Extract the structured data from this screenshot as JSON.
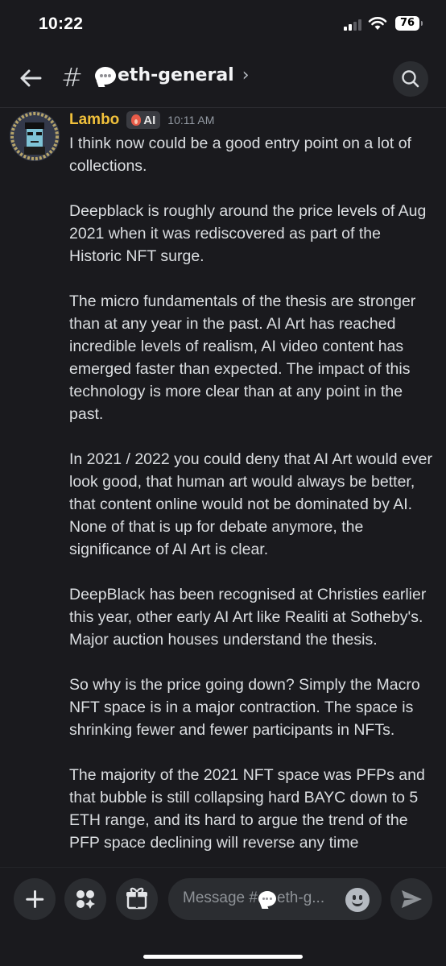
{
  "status_bar": {
    "time": "10:22",
    "battery": "76",
    "signal_bars_active": 2,
    "signal_bars_total": 4
  },
  "header": {
    "channel_prefix": "#",
    "channel_name": "eth-general",
    "channel_emoji_icon": "speech-bubble-icon",
    "chevron": "›"
  },
  "message": {
    "username": "Lambo",
    "tag": "AI",
    "timestamp": "10:11 AM",
    "paragraphs": [
      "I think now could be a good entry point on a lot of collections.",
      "Deepblack is roughly around the price levels of Aug 2021 when it was rediscovered as part of the Historic NFT surge.",
      "The micro fundamentals of the thesis are stronger than at any year in the past. AI Art has reached incredible levels of realism, AI video content has emerged faster than expected. The impact of this technology is more clear than at any point in the past.",
      "In 2021 / 2022 you could deny that AI Art would ever look good, that human art would always be better, that content online would not be dominated by AI. None of that is up for debate anymore, the significance of AI Art is clear.",
      "DeepBlack has been recognised at Christies earlier this year, other early AI Art like Realiti at Sotheby's. Major auction houses understand the thesis.",
      "So why is the price going down? Simply the Macro NFT space is in a major contraction. The space is shrinking fewer and fewer participants in NFTs.",
      "The majority of the 2021 NFT space was PFPs and that bubble is still collapsing hard BAYC down to 5 ETH range, and its hard to argue the trend of the PFP space declining will reverse any time"
    ]
  },
  "composer": {
    "placeholder_prefix": "Message #",
    "placeholder_suffix": "eth-g..."
  },
  "colors": {
    "background": "#1a1a1e",
    "username": "#f0c03b",
    "text": "#dbdee1",
    "muted": "#949ba4"
  }
}
